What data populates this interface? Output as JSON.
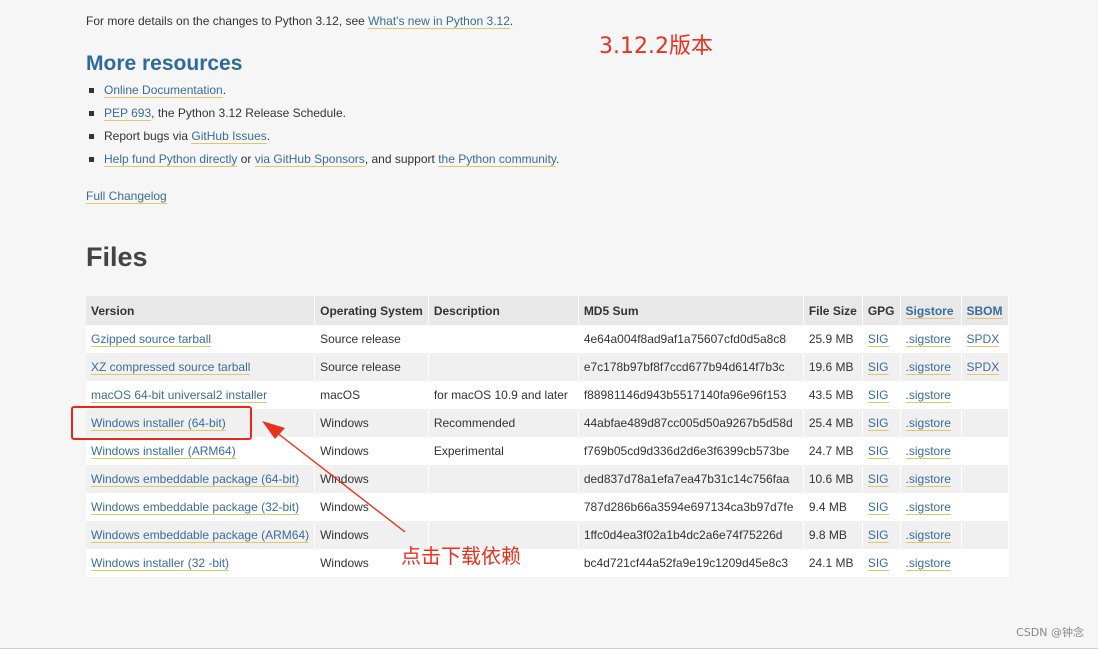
{
  "intro": {
    "prefix": "For more details on the changes to Python 3.12, see ",
    "link": "What's new in Python 3.12",
    "suffix": "."
  },
  "annotation_version": "3.12.2版本",
  "resources": {
    "heading": "More resources",
    "items": [
      {
        "link": "Online Documentation",
        "text": "."
      },
      {
        "link": "PEP 693",
        "text": ", the Python 3.12 Release Schedule."
      },
      {
        "pre": "Report bugs via ",
        "link": "GitHub Issues",
        "text": "."
      },
      {
        "link": "Help fund Python directly",
        "mid": " or ",
        "link2": "via GitHub Sponsors",
        "mid2": ", and support ",
        "link3": "the Python community",
        "text": "."
      }
    ],
    "changelog": "Full Changelog"
  },
  "files": {
    "heading": "Files",
    "columns": [
      "Version",
      "Operating System",
      "Description",
      "MD5 Sum",
      "File Size",
      "GPG",
      "Sigstore",
      "SBOM"
    ],
    "rows": [
      {
        "version": "Gzipped source tarball",
        "os": "Source release",
        "desc": "",
        "md5": "4e64a004f8ad9af1a75607cfd0d5a8c8",
        "size": "25.9 MB",
        "gpg": "SIG",
        "sigstore": ".sigstore",
        "sbom": "SPDX"
      },
      {
        "version": "XZ compressed source tarball",
        "os": "Source release",
        "desc": "",
        "md5": "e7c178b97bf8f7ccd677b94d614f7b3c",
        "size": "19.6 MB",
        "gpg": "SIG",
        "sigstore": ".sigstore",
        "sbom": "SPDX"
      },
      {
        "version": "macOS 64-bit universal2 installer",
        "os": "macOS",
        "desc": "for macOS 10.9 and later",
        "md5": "f88981146d943b5517140fa96e96f153",
        "size": "43.5 MB",
        "gpg": "SIG",
        "sigstore": ".sigstore",
        "sbom": ""
      },
      {
        "version": "Windows installer (64-bit)",
        "os": "Windows",
        "desc": "Recommended",
        "md5": "44abfae489d87cc005d50a9267b5d58d",
        "size": "25.4 MB",
        "gpg": "SIG",
        "sigstore": ".sigstore",
        "sbom": ""
      },
      {
        "version": "Windows installer (ARM64)",
        "os": "Windows",
        "desc": "Experimental",
        "md5": "f769b05cd9d336d2d6e3f6399cb573be",
        "size": "24.7 MB",
        "gpg": "SIG",
        "sigstore": ".sigstore",
        "sbom": ""
      },
      {
        "version": "Windows embeddable package (64-bit)",
        "os": "Windows",
        "desc": "",
        "md5": "ded837d78a1efa7ea47b31c14c756faa",
        "size": "10.6 MB",
        "gpg": "SIG",
        "sigstore": ".sigstore",
        "sbom": ""
      },
      {
        "version": "Windows embeddable package (32-bit)",
        "os": "Windows",
        "desc": "",
        "md5": "787d286b66a3594e697134ca3b97d7fe",
        "size": "9.4 MB",
        "gpg": "SIG",
        "sigstore": ".sigstore",
        "sbom": ""
      },
      {
        "version": "Windows embeddable package (ARM64)",
        "os": "Windows",
        "desc": "",
        "md5": "1ffc0d4ea3f02a1b4dc2a6e74f75226d",
        "size": "9.8 MB",
        "gpg": "SIG",
        "sigstore": ".sigstore",
        "sbom": ""
      },
      {
        "version": "Windows installer (32 -bit)",
        "os": "Windows",
        "desc": "",
        "md5": "bc4d721cf44a52fa9e19c1209d45e8c3",
        "size": "24.1 MB",
        "gpg": "SIG",
        "sigstore": ".sigstore",
        "sbom": ""
      }
    ]
  },
  "annotation_click": "点击下载依赖",
  "watermark": "CSDN @钟念",
  "colors": {
    "link": "#3a6c9b",
    "annotation": "#e8311f",
    "heading_blue": "#2f6a9c"
  }
}
